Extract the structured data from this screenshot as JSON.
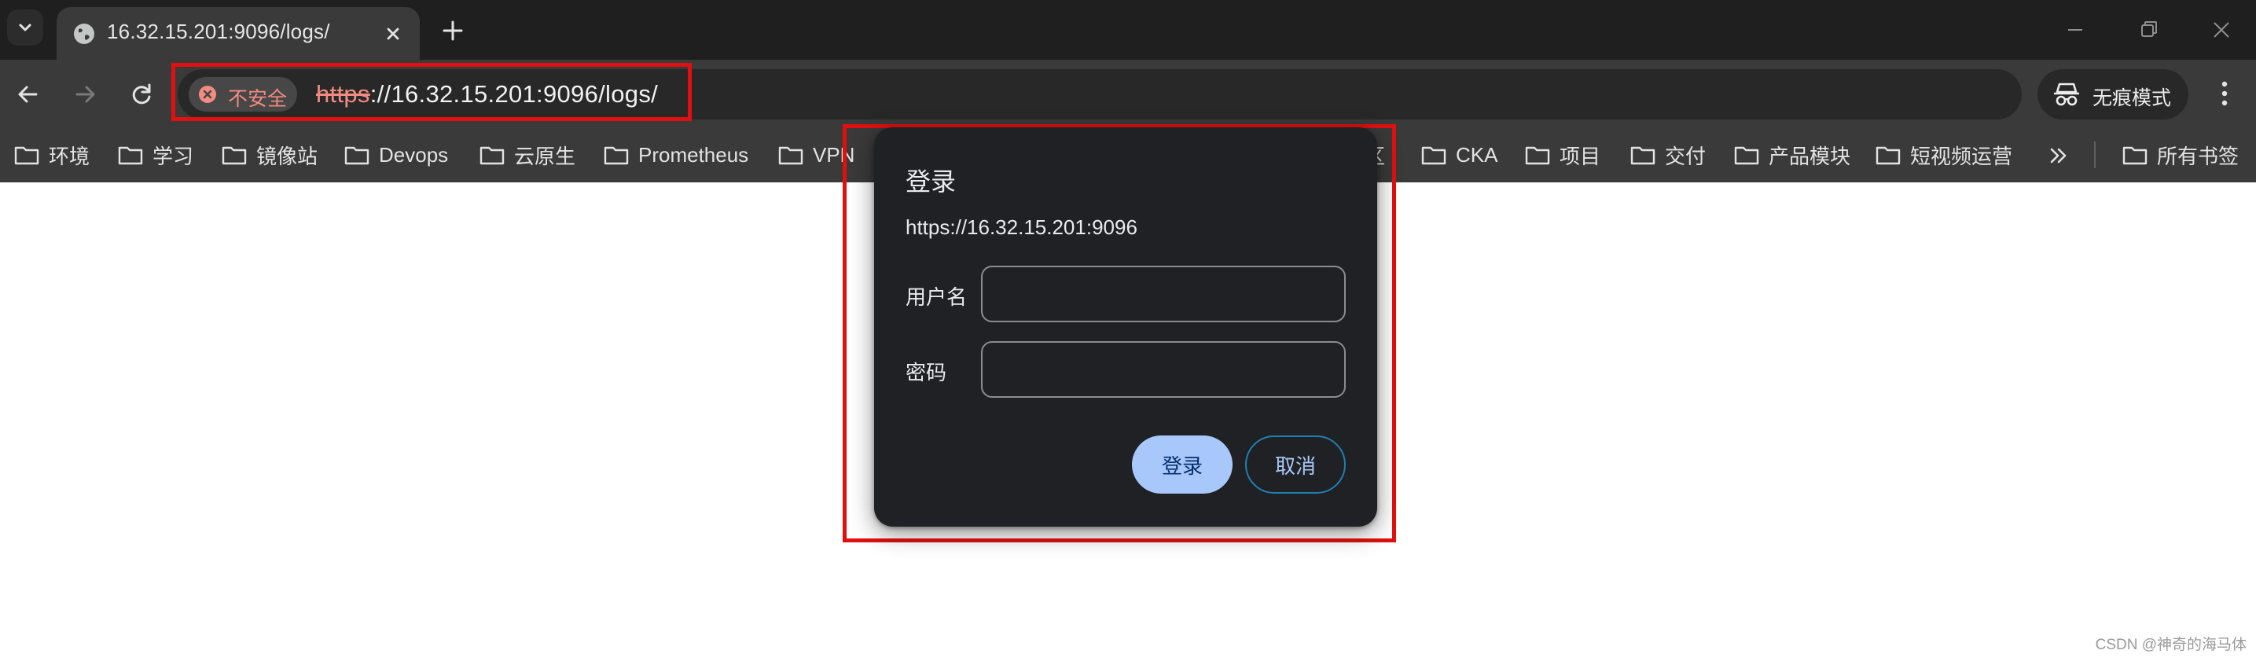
{
  "colors": {
    "tabstrip_bg": "#1f1f1f",
    "toolbar_bg": "#3a3a3a",
    "omnibox_bg": "#282828",
    "insecure_red": "#f28b82",
    "dialog_bg": "#202124",
    "primary_button": "#a8c7fa",
    "annotation_red": "#e01010"
  },
  "tabstrip": {
    "tab_search_icon": "chevron-down-icon",
    "active_tab": {
      "title": "16.32.15.201:9096/logs/",
      "favicon": "globe-icon"
    },
    "new_tab_icon": "plus-icon",
    "window_controls": [
      "minimize-icon",
      "restore-icon",
      "close-icon"
    ]
  },
  "toolbar": {
    "security_chip": {
      "label": "不安全",
      "icon": "warning-x-icon"
    },
    "url": {
      "scheme": "https",
      "rest": "://16.32.15.201:9096/logs/"
    },
    "incognito": {
      "label": "无痕模式",
      "icon": "incognito-icon"
    },
    "menu_icon": "kebab-menu-icon"
  },
  "bookmarks": {
    "items": [
      {
        "label": "环境"
      },
      {
        "label": "学习"
      },
      {
        "label": "镜像站"
      },
      {
        "label": "Devops"
      },
      {
        "label": "云原生"
      },
      {
        "label": "Prometheus"
      },
      {
        "label": "VPN"
      },
      {
        "label": "区"
      },
      {
        "label": "CKA"
      },
      {
        "label": "项目"
      },
      {
        "label": "交付"
      },
      {
        "label": "产品模块"
      },
      {
        "label": "短视频运营"
      }
    ],
    "all_bookmarks": {
      "label": "所有书签"
    }
  },
  "dialog": {
    "title": "登录",
    "origin": "https://16.32.15.201:9096",
    "username_label": "用户名",
    "username_value": "",
    "password_label": "密码",
    "password_value": "",
    "login_button": "登录",
    "cancel_button": "取消"
  },
  "watermark": "CSDN @神奇的海马体"
}
